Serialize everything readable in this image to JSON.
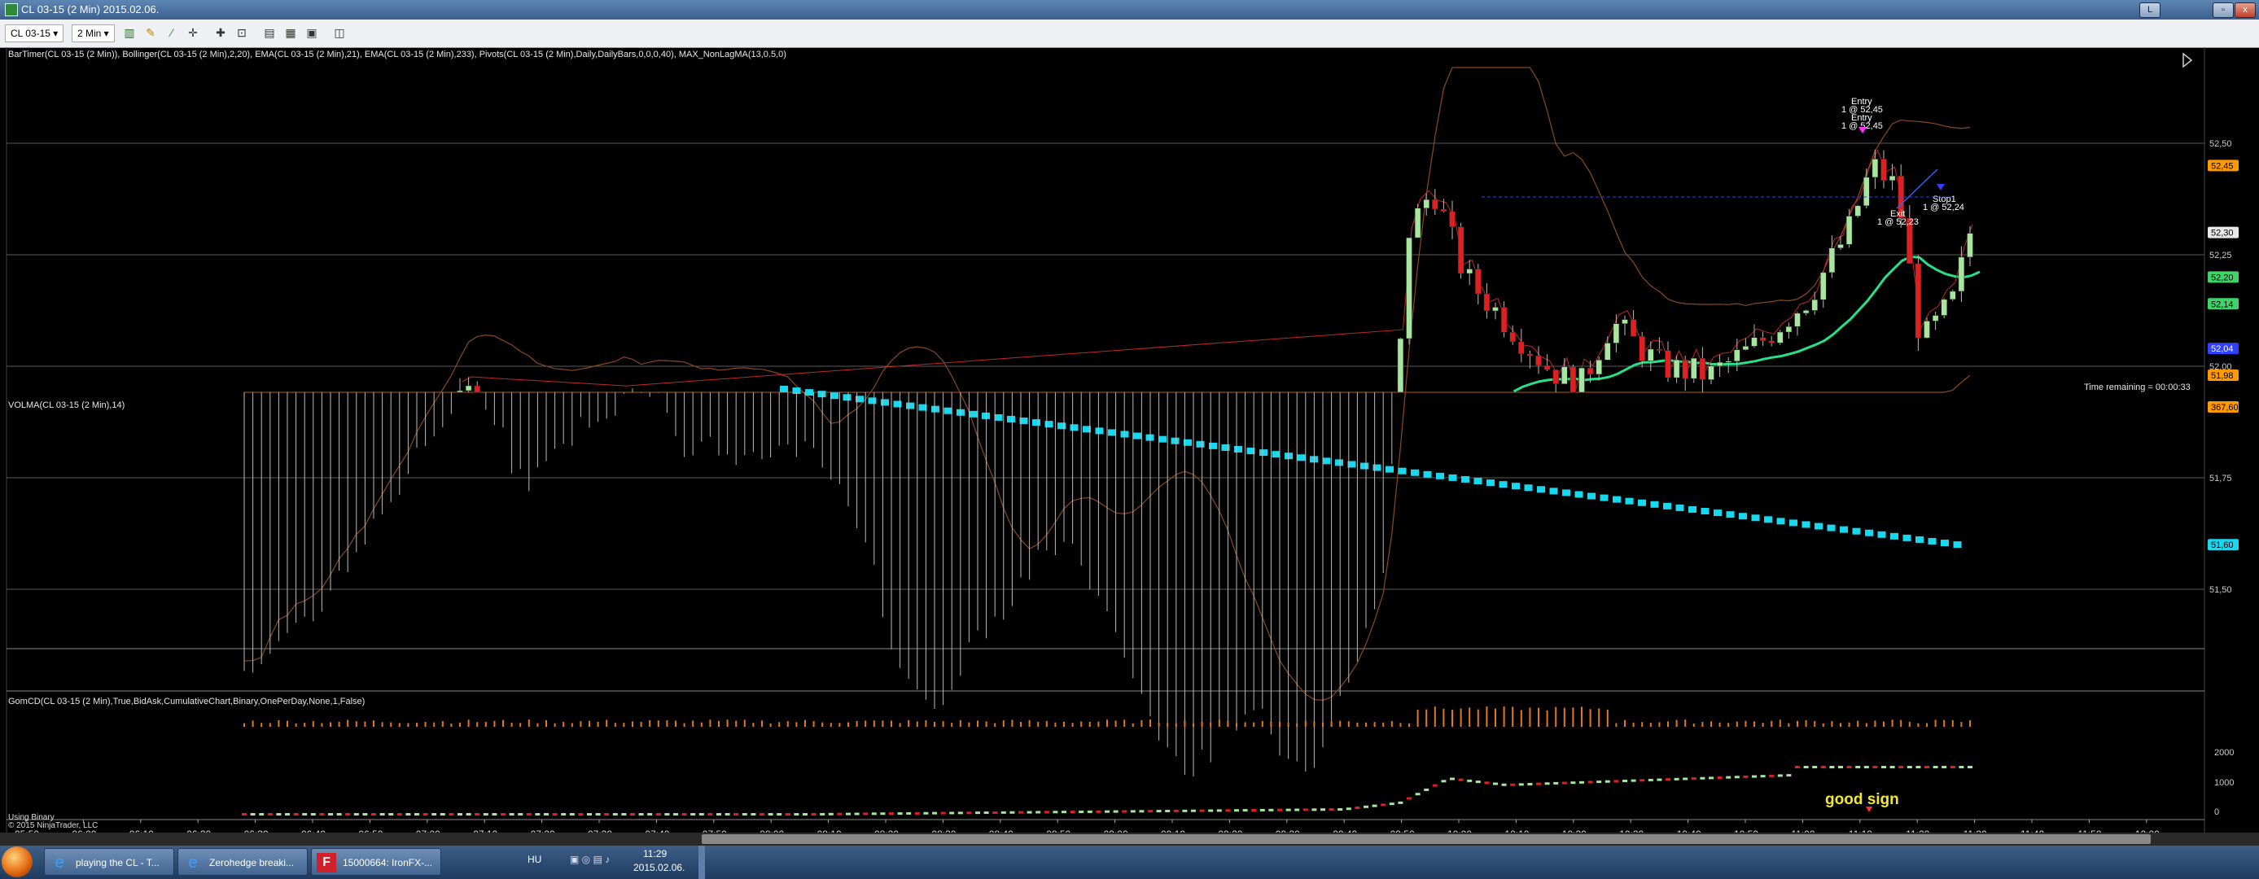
{
  "window": {
    "title": "CL 03-15 (2 Min)  2015.02.06.",
    "btn_min": "L",
    "btn_restore": "▫",
    "btn_close": "x"
  },
  "toolbar": {
    "instrument": "CL 03-15",
    "interval": "2 Min"
  },
  "indicators_label": "BarTimer(CL 03-15 (2 Min)), Bollinger(CL 03-15 (2 Min),2,20), EMA(CL 03-15 (2 Min),21), EMA(CL 03-15 (2 Min),233), Pivots(CL 03-15 (2 Min),Daily,DailyBars,0,0,0,40), MAX_NonLagMA(13,0.5,0)",
  "time_remaining": "Time remaining = 00:00:33",
  "price_axis": {
    "ticks": [
      "52,50",
      "52,25",
      "52,00",
      "51,75",
      "51,50"
    ]
  },
  "price_flags": [
    {
      "text": "52,45",
      "color": "#ff9900"
    },
    {
      "text": "52,30",
      "color": "#e8e8e8"
    },
    {
      "text": "52,20",
      "color": "#3fd46a"
    },
    {
      "text": "52,14",
      "color": "#3fd46a"
    },
    {
      "text": "52,04",
      "color": "#3040ff"
    },
    {
      "text": "51,98",
      "color": "#ff9900"
    },
    {
      "text": "51,60",
      "color": "#18d8f0"
    }
  ],
  "trade_markers": {
    "entry1_title": "Entry",
    "entry1_detail": "1 @ 52,45",
    "entry2_title": "Entry",
    "entry2_detail": "1 @ 52,45",
    "stop_title": "Stop1",
    "stop_detail": "1 @ 52,24",
    "exit_title": "Exit",
    "exit_detail": "1 @ 52,23"
  },
  "volma_label": "VOLMA(CL 03-15 (2 Min),14)",
  "volma_flag": "367,60",
  "gomcd_label": "GomCD(CL 03-15 (2 Min),True,BidAsk,CumulativeChart,Binary,OnePerDay,None,1,False)",
  "gomcd_axis": [
    "2000",
    "1000",
    "0"
  ],
  "annotation": "good sign",
  "footer": {
    "line1": "Using Binary",
    "line2": "© 2015 NinjaTrader, LLC"
  },
  "time_axis": [
    "05:50",
    "06:00",
    "06:10",
    "06:20",
    "06:30",
    "06:40",
    "06:50",
    "07:00",
    "07:10",
    "07:20",
    "07:30",
    "07:40",
    "07:50",
    "08:00",
    "08:10",
    "08:20",
    "08:30",
    "08:40",
    "08:50",
    "09:00",
    "09:10",
    "09:20",
    "09:30",
    "09:40",
    "09:50",
    "10:00",
    "10:10",
    "10:20",
    "10:30",
    "10:40",
    "10:50",
    "11:00",
    "11:10",
    "11:20",
    "11:30",
    "11:40",
    "11:50",
    "12:00"
  ],
  "taskbar": {
    "tasks": [
      "playing the CL - T...",
      "Zerohedge breaki...",
      "15000664: IronFX-..."
    ],
    "lang": "HU",
    "time": "11:29",
    "date": "2015.02.06."
  },
  "colors": {
    "bull": "#a8e6a0",
    "bear": "#e02020",
    "ema21": "#28e08a",
    "ema233": "#18d8f0",
    "bollinger": "#8a4a20",
    "volume": "#e07a20"
  }
}
